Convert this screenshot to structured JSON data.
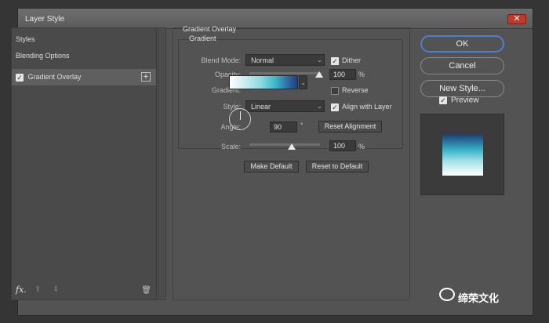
{
  "window": {
    "title": "Layer Style",
    "close_glyph": "✕"
  },
  "left_panel": {
    "items": [
      {
        "label": "Styles"
      },
      {
        "label": "Blending Options"
      },
      {
        "label": "Gradient Overlay",
        "checked": true,
        "add_glyph": "+"
      }
    ],
    "footer": {
      "fx": "fx",
      "fx_dot": ".",
      "up": "⬆",
      "down": "⬇",
      "trash": "🗑"
    }
  },
  "section": {
    "title": "Gradient Overlay",
    "subtitle": "Gradient",
    "blend_mode": {
      "label": "Blend Mode:",
      "value": "Normal",
      "chevron": "⌄"
    },
    "dither": {
      "label": "Dither",
      "checked": true
    },
    "opacity": {
      "label": "Opacity:",
      "value": "100",
      "unit": "%",
      "level": 1.0
    },
    "gradient": {
      "label": "Gradient:",
      "chevron": "⌄"
    },
    "reverse": {
      "label": "Reverse",
      "checked": false
    },
    "style": {
      "label": "Style:",
      "value": "Linear",
      "chevron": "⌄"
    },
    "align": {
      "label": "Align with Layer",
      "checked": true
    },
    "angle": {
      "label": "Angle:",
      "value": "90",
      "unit": "°"
    },
    "reset_alignment": "Reset Alignment",
    "scale": {
      "label": "Scale:",
      "value": "100",
      "unit": "%",
      "level": 0.6
    },
    "make_default": "Make Default",
    "reset_default": "Reset to Default"
  },
  "actions": {
    "ok": "OK",
    "cancel": "Cancel",
    "new_style": "New Style..."
  },
  "preview": {
    "label": "Preview",
    "checked": true
  },
  "watermark": {
    "text": "缔荣文化"
  },
  "colors": {
    "accent": "#4f7dc9",
    "gradient_start": "#ffffff",
    "gradient_mid": "#3ab5c9",
    "gradient_end": "#1f3f7a"
  }
}
